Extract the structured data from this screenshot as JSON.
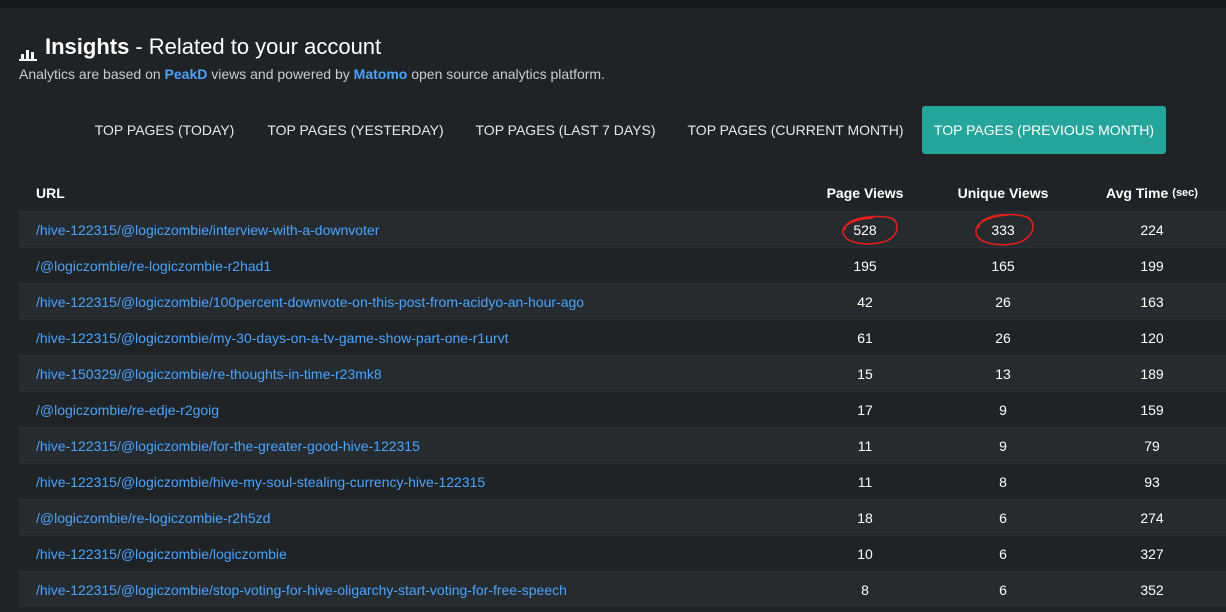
{
  "header": {
    "title_strong": "Insights",
    "title_rest": "- Related to your account",
    "subtitle_prefix": "Analytics are based on",
    "subtitle_link1": "PeakD",
    "subtitle_middle": "views and powered by",
    "subtitle_link2": "Matomo",
    "subtitle_suffix": "open source analytics platform."
  },
  "tabs": [
    {
      "label": "TOP PAGES (TODAY)"
    },
    {
      "label": "TOP PAGES (YESTERDAY)"
    },
    {
      "label": "TOP PAGES (LAST 7 DAYS)"
    },
    {
      "label": "TOP PAGES (CURRENT MONTH)"
    },
    {
      "label": "TOP PAGES (PREVIOUS MONTH)",
      "active": true
    }
  ],
  "table": {
    "headers": {
      "url": "URL",
      "page_views": "Page Views",
      "unique_views": "Unique Views",
      "avg_time": "Avg Time",
      "avg_time_unit": "(sec)"
    },
    "rows": [
      {
        "url": "/hive-122315/@logiczombie/interview-with-a-downvoter",
        "page_views": "528",
        "unique_views": "333",
        "avg_time": "224"
      },
      {
        "url": "/@logiczombie/re-logiczombie-r2had1",
        "page_views": "195",
        "unique_views": "165",
        "avg_time": "199"
      },
      {
        "url": "/hive-122315/@logiczombie/100percent-downvote-on-this-post-from-acidyo-an-hour-ago",
        "page_views": "42",
        "unique_views": "26",
        "avg_time": "163"
      },
      {
        "url": "/hive-122315/@logiczombie/my-30-days-on-a-tv-game-show-part-one-r1urvt",
        "page_views": "61",
        "unique_views": "26",
        "avg_time": "120"
      },
      {
        "url": "/hive-150329/@logiczombie/re-thoughts-in-time-r23mk8",
        "page_views": "15",
        "unique_views": "13",
        "avg_time": "189"
      },
      {
        "url": "/@logiczombie/re-edje-r2goig",
        "page_views": "17",
        "unique_views": "9",
        "avg_time": "159"
      },
      {
        "url": "/hive-122315/@logiczombie/for-the-greater-good-hive-122315",
        "page_views": "11",
        "unique_views": "9",
        "avg_time": "79"
      },
      {
        "url": "/hive-122315/@logiczombie/hive-my-soul-stealing-currency-hive-122315",
        "page_views": "11",
        "unique_views": "8",
        "avg_time": "93"
      },
      {
        "url": "/@logiczombie/re-logiczombie-r2h5zd",
        "page_views": "18",
        "unique_views": "6",
        "avg_time": "274"
      },
      {
        "url": "/hive-122315/@logiczombie/logiczombie",
        "page_views": "10",
        "unique_views": "6",
        "avg_time": "327"
      },
      {
        "url": "/hive-122315/@logiczombie/stop-voting-for-hive-oligarchy-start-voting-for-free-speech",
        "page_views": "8",
        "unique_views": "6",
        "avg_time": "352"
      }
    ]
  },
  "colors": {
    "page_bg": "#171a1d",
    "panel_bg": "#1f2326",
    "row_alt_bg": "#262b2f",
    "link": "#4aa3ff",
    "active_tab": "#26a69a",
    "annotation_red": "#e0201b"
  },
  "icons": {
    "title_icon": "bar-chart-icon"
  }
}
